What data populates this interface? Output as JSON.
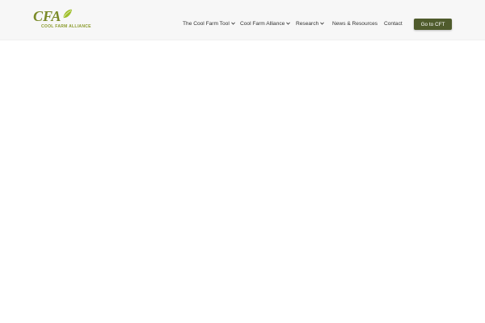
{
  "logo": {
    "mark": "CFA",
    "subtitle": "COOL FARM ALLIANCE",
    "icon": "leaf-icon",
    "colors": {
      "mark": "#7a8a27",
      "leaf": "#9fbf2b"
    }
  },
  "nav": {
    "items": [
      {
        "label": "The Cool Farm Tool",
        "has_dropdown": true
      },
      {
        "label": "Cool Farm Alliance",
        "has_dropdown": true
      },
      {
        "label": "Research",
        "has_dropdown": true
      },
      {
        "label": "News & Resources",
        "has_dropdown": false
      },
      {
        "label": "Contact",
        "has_dropdown": false
      }
    ]
  },
  "cta": {
    "label": "Go to CFT",
    "color": "#4f5b2c"
  },
  "colors": {
    "header_bg": "#f7f7f7",
    "page_bg": "#ffffff",
    "nav_text": "#333333"
  }
}
